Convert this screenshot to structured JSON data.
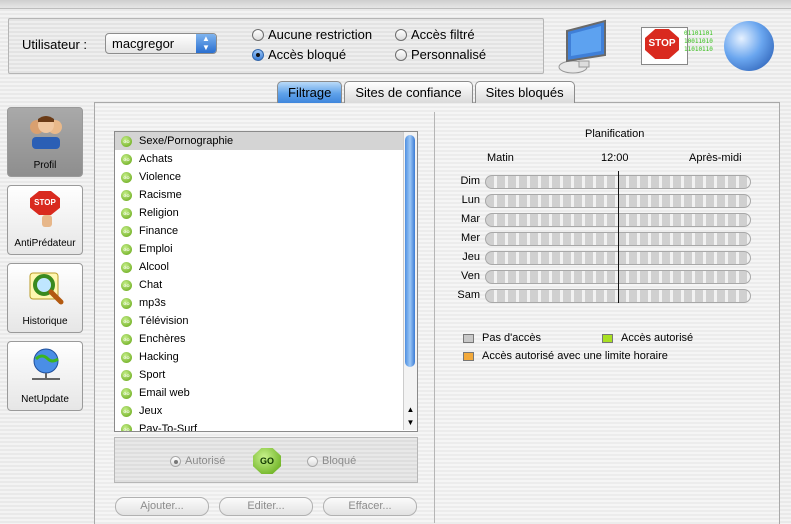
{
  "header": {
    "user_label": "Utilisateur :",
    "user_value": "macgregor",
    "options": [
      {
        "label": "Aucune restriction",
        "selected": false
      },
      {
        "label": "Accès filtré",
        "selected": false
      },
      {
        "label": "Accès bloqué",
        "selected": true
      },
      {
        "label": "Personnalisé",
        "selected": false
      }
    ],
    "logo_stop_text": "STOP",
    "binary_lines": [
      "01101101",
      "10011010",
      "11010110"
    ]
  },
  "tabs": [
    {
      "label": "Filtrage",
      "active": true
    },
    {
      "label": "Sites de confiance",
      "active": false
    },
    {
      "label": "Sites bloqués",
      "active": false
    }
  ],
  "sidebar": [
    {
      "label": "Profil",
      "icon": "people-icon",
      "active": true
    },
    {
      "label": "AntiPrédateur",
      "icon": "stop-hand-icon",
      "active": false,
      "icon_text": "STOP"
    },
    {
      "label": "Historique",
      "icon": "magnifier-icon",
      "active": false
    },
    {
      "label": "NetUpdate",
      "icon": "globe-network-icon",
      "active": false
    }
  ],
  "categories": [
    "Sexe/Pornographie",
    "Achats",
    "Violence",
    "Racisme",
    "Religion",
    "Finance",
    "Emploi",
    "Alcool",
    "Chat",
    "mp3s",
    "Télévision",
    "Enchères",
    "Hacking",
    "Sport",
    "Email web",
    "Jeux",
    "Pay-To-Surf"
  ],
  "go_badge_text": "GO",
  "status": {
    "autorise_label": "Autorisé",
    "bloque_label": "Bloqué",
    "go_label": "GO"
  },
  "buttons": {
    "add": "Ajouter...",
    "edit": "Editer...",
    "delete": "Effacer..."
  },
  "schedule": {
    "title": "Planification",
    "morning": "Matin",
    "noon": "12:00",
    "afternoon": "Après-midi",
    "days": [
      "Dim",
      "Lun",
      "Mar",
      "Mer",
      "Jeu",
      "Ven",
      "Sam"
    ],
    "legend": {
      "none": "Pas d'accès",
      "allowed": "Accès autorisé",
      "limited": "Accès autorisé avec une limite horaire"
    },
    "colors": {
      "none": "#c8c8c8",
      "allowed": "#a9e022",
      "limited": "#f2a93b"
    }
  }
}
